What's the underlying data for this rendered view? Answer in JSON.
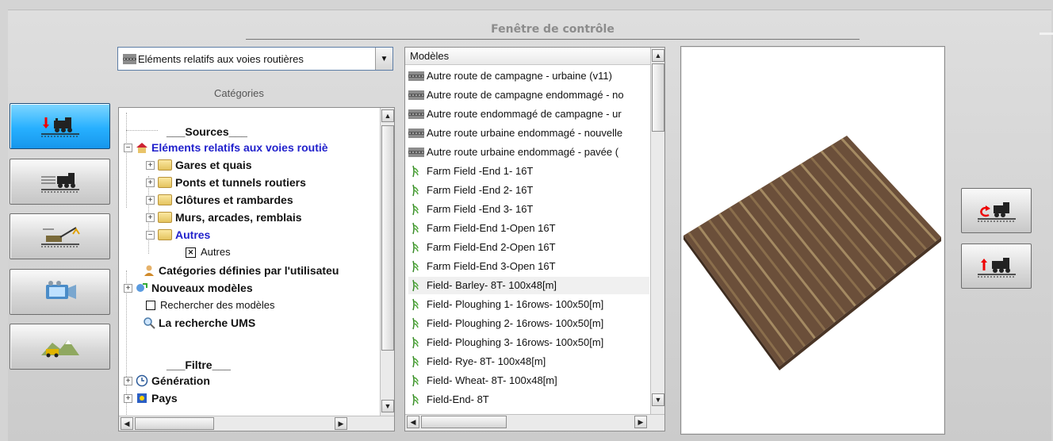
{
  "window": {
    "title": "Fenêtre de contrôle"
  },
  "left_buttons": [
    {
      "icon": "train-import-icon",
      "active": true
    },
    {
      "icon": "train-on-tracks-icon",
      "active": false
    },
    {
      "icon": "crane-icon",
      "active": false
    },
    {
      "icon": "camera-icon",
      "active": false
    },
    {
      "icon": "terrain-editor-icon",
      "active": false
    }
  ],
  "dropdown": {
    "selected": "Eléments relatifs aux voies routières"
  },
  "categories": {
    "label": "Catégories",
    "sources_heading": "___Sources___",
    "root_selected": "Eléments relatifs aux voies routiè",
    "children": [
      "Gares et quais",
      "Ponts et tunnels routiers",
      "Clôtures et rambardes",
      "Murs, arcades, remblais",
      "Autres"
    ],
    "autres_leaf": "Autres",
    "user_categories": "Catégories définies par l'utilisateu",
    "new_models": "Nouveaux modèles",
    "search_models": "Rechercher des modèles",
    "ums_search": "La recherche UMS",
    "filter_heading": "___Filtre___",
    "generation": "Génération",
    "country": "Pays"
  },
  "models": {
    "header": "Modèles",
    "items": [
      "Autre route de campagne - urbaine (v11)",
      "Autre route de campagne endommagé - no",
      "Autre route endommagé de campagne - ur",
      "Autre route urbaine endommagé - nouvelle",
      "Autre route urbaine endommagé - pavée (",
      "Farm Field -End 1- 16T",
      "Farm Field -End 2- 16T",
      "Farm Field -End 3- 16T",
      "Farm Field-End 1-Open 16T",
      "Farm Field-End 2-Open 16T",
      "Farm Field-End 3-Open 16T",
      "Field- Barley- 8T- 100x48[m]",
      "Field- Ploughing 1- 16rows- 100x50[m]",
      "Field- Ploughing 2- 16rows- 100x50[m]",
      "Field- Ploughing 3- 16rows- 100x50[m]",
      "Field- Rye- 8T- 100x48[m]",
      "Field- Wheat- 8T- 100x48[m]",
      "Field-End- 8T"
    ],
    "highlighted_index": 11
  },
  "preview": {
    "subject": "field-3d-preview"
  },
  "right_buttons": [
    {
      "icon": "train-rotate-icon"
    },
    {
      "icon": "train-export-icon"
    }
  ],
  "colors": {
    "active_button": "#27b0ff",
    "selected_category": "#2222cc",
    "field_soil": "#6b4f3a"
  }
}
